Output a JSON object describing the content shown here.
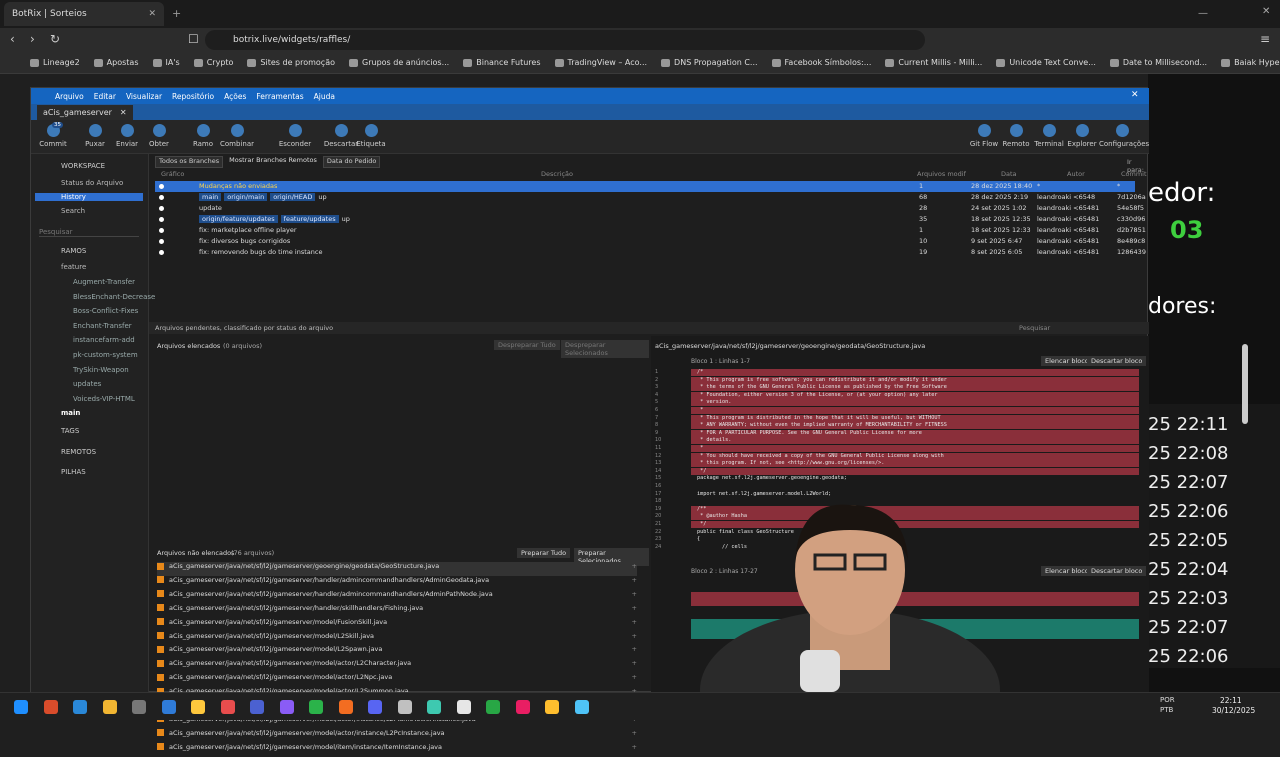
{
  "browser": {
    "tab_title": "BotRix | Sorteios",
    "url": "botrix.live/widgets/raffles/",
    "bookmarks": [
      "Lineage2",
      "Apostas",
      "IA's",
      "Crypto",
      "Sites de promoção",
      "Grupos de anúncios...",
      "Binance Futures",
      "TradingView – Aco...",
      "DNS Propagation C...",
      "Facebook Símbolos:...",
      "Current Millis - Milli...",
      "Unicode Text Conve...",
      "Date to Millisecond...",
      "Baiak Hyper [8.60] –..."
    ]
  },
  "webpage": {
    "winner_text": "edor:",
    "code": "03",
    "participants_text": "dores:",
    "times": [
      "25 22:11",
      "25 22:08",
      "25 22:07",
      "25 22:06",
      "25 22:05",
      "25 22:04",
      "25 22:03",
      "25 22:07",
      "25 22:06"
    ]
  },
  "app": {
    "menu": [
      "Arquivo",
      "Editar",
      "Visualizar",
      "Repositório",
      "Ações",
      "Ferramentas",
      "Ajuda"
    ],
    "tab": "aCis_gameserver",
    "toolbar": [
      "Commit",
      "Puxar",
      "Enviar",
      "Obter",
      "Ramo",
      "Combinar",
      "Esconder",
      "Descartar",
      "Etiqueta"
    ],
    "toolbar_right": [
      "Git Flow",
      "Remoto",
      "Terminal",
      "Explorer",
      "Configurações"
    ],
    "commit_badge": "35",
    "sidebar": {
      "workspace": "WORKSPACE",
      "items": [
        "Status do Arquivo",
        "History",
        "Search"
      ],
      "search_placeholder": "Pesquisar",
      "ramos": "RAMOS",
      "feature": "feature",
      "branches": [
        "Augment-Transfer",
        "BlessEnchant-Decrease",
        "Boss-Conflict-Fixes",
        "Enchant-Transfer",
        "instancefarm-add",
        "pk-custom-system",
        "TrySkin-Weapon",
        "updates",
        "Voiceds-VIP-HTML"
      ],
      "main": "main",
      "tags": "TAGS",
      "remotos": "REMOTOS",
      "pilhas": "PILHAS"
    },
    "filters": {
      "branches": "Todos os Branches",
      "show_remote": "Mostrar Branches Remotos",
      "order": "Data do Pedido",
      "ir_para": "Ir para:"
    },
    "graph_headers": [
      "Gráfico",
      "Descrição",
      "Arquivos modif",
      "Data",
      "Autor",
      "Commit"
    ],
    "commits": [
      {
        "desc": "Mudanças não enviadas",
        "files": "1",
        "date": "28 dez 2025 18:40",
        "author": "*",
        "hash": "*",
        "tags": []
      },
      {
        "desc": "up",
        "files": "68",
        "date": "28 dez 2025 2:19",
        "author": "leandroaki <6548",
        "hash": "7d1206a",
        "tags": [
          "main",
          "origin/main",
          "origin/HEAD"
        ]
      },
      {
        "desc": "update",
        "files": "28",
        "date": "24 set 2025 1:02",
        "author": "leandroaki <65481",
        "hash": "54e58f5",
        "tags": []
      },
      {
        "desc": "up",
        "files": "35",
        "date": "18 set 2025 12:35",
        "author": "leandroaki <65481",
        "hash": "c330d96",
        "tags": [
          "origin/feature/updates",
          "feature/updates"
        ]
      },
      {
        "desc": "fix: marketplace offline player",
        "files": "1",
        "date": "18 set 2025 12:33",
        "author": "leandroaki <65481",
        "hash": "d2b7851",
        "tags": []
      },
      {
        "desc": "fix: diversos bugs corrigidos",
        "files": "10",
        "date": "9 set 2025 6:47",
        "author": "leandroaki <65481",
        "hash": "8e489c8",
        "tags": []
      },
      {
        "desc": "fix: removendo bugs do time instance",
        "files": "19",
        "date": "8 set 2025 6:05",
        "author": "leandroaki <65481",
        "hash": "1286439",
        "tags": []
      }
    ],
    "pending": {
      "label": "Arquivos pendentes, classificado por status do arquivo",
      "search": "Pesquisar",
      "staged": "Arquivos elencados",
      "staged_count": "(0 arquivos)",
      "unstage_all": "Despreparar Tudo",
      "unstage_sel": "Despreparar Selecionados",
      "unstaged": "Arquivos não elencados",
      "unstaged_count": "(76 arquivos)",
      "stage_all": "Preparar Tudo",
      "stage_sel": "Preparar Selecionados"
    },
    "files": [
      "aCis_gameserver/java/net/sf/l2j/gameserver/geoengine/geodata/GeoStructure.java",
      "aCis_gameserver/java/net/sf/l2j/gameserver/handler/admincommandhandlers/AdminGeodata.java",
      "aCis_gameserver/java/net/sf/l2j/gameserver/handler/admincommandhandlers/AdminPathNode.java",
      "aCis_gameserver/java/net/sf/l2j/gameserver/handler/skillhandlers/Fishing.java",
      "aCis_gameserver/java/net/sf/l2j/gameserver/model/FusionSkill.java",
      "aCis_gameserver/java/net/sf/l2j/gameserver/model/L2Skill.java",
      "aCis_gameserver/java/net/sf/l2j/gameserver/model/L2Spawn.java",
      "aCis_gameserver/java/net/sf/l2j/gameserver/model/actor/L2Character.java",
      "aCis_gameserver/java/net/sf/l2j/gameserver/model/actor/L2Npc.java",
      "aCis_gameserver/java/net/sf/l2j/gameserver/model/actor/L2Summon.java",
      "aCis_gameserver/java/net/sf/l2j/gameserver/model/actor/instance/L2ControlTowerInstance.java",
      "aCis_gameserver/java/net/sf/l2j/gameserver/model/actor/instance/L2FlameTowerInstance.java",
      "aCis_gameserver/java/net/sf/l2j/gameserver/model/actor/instance/L2PcInstance.java",
      "aCis_gameserver/java/net/sf/l2j/gameserver/model/item/instance/ItemInstance.java"
    ],
    "diff": {
      "file": "aCis_gameserver/java/net/sf/l2j/gameserver/geoengine/geodata/GeoStructure.java",
      "hunk1": "Bloco 1 : Linhas 1-7",
      "hunk2": "Bloco 2 : Linhas 17-27",
      "stage_hunk": "Elencar bloco",
      "discard_hunk": "Descartar bloco",
      "lines": [
        {
          "t": "red",
          "s": "/*"
        },
        {
          "t": "red",
          "s": " * This program is free software: you can redistribute it and/or modify it under"
        },
        {
          "t": "red",
          "s": " * the terms of the GNU General Public License as published by the Free Software"
        },
        {
          "t": "red",
          "s": " * Foundation, either version 3 of the License, or (at your option) any later"
        },
        {
          "t": "red",
          "s": " * version."
        },
        {
          "t": "red",
          "s": " *"
        },
        {
          "t": "red",
          "s": " * This program is distributed in the hope that it will be useful, but WITHOUT"
        },
        {
          "t": "red",
          "s": " * ANY WARRANTY; without even the implied warranty of MERCHANTABILITY or FITNESS"
        },
        {
          "t": "red",
          "s": " * FOR A PARTICULAR PURPOSE. See the GNU General Public License for more"
        },
        {
          "t": "red",
          "s": " * details."
        },
        {
          "t": "red",
          "s": " *"
        },
        {
          "t": "red",
          "s": " * You should have received a copy of the GNU General Public License along with"
        },
        {
          "t": "red",
          "s": " * this program. If not, see <http://www.gnu.org/licenses/>."
        },
        {
          "t": "red",
          "s": " */"
        },
        {
          "t": "",
          "s": "package net.sf.l2j.gameserver.geoengine.geodata;"
        },
        {
          "t": "",
          "s": ""
        },
        {
          "t": "",
          "s": "import net.sf.l2j.gameserver.model.L2World;"
        },
        {
          "t": "",
          "s": ""
        },
        {
          "t": "red",
          "s": "/**"
        },
        {
          "t": "red",
          "s": " * @author Hasha"
        },
        {
          "t": "red",
          "s": " */"
        },
        {
          "t": "",
          "s": "public final class GeoStructure"
        },
        {
          "t": "",
          "s": "{"
        },
        {
          "t": "",
          "s": "\t// cells"
        }
      ]
    }
  },
  "taskbar": {
    "lang": "POR",
    "layout": "PTB",
    "time": "22:11",
    "date": "30/12/2025"
  }
}
